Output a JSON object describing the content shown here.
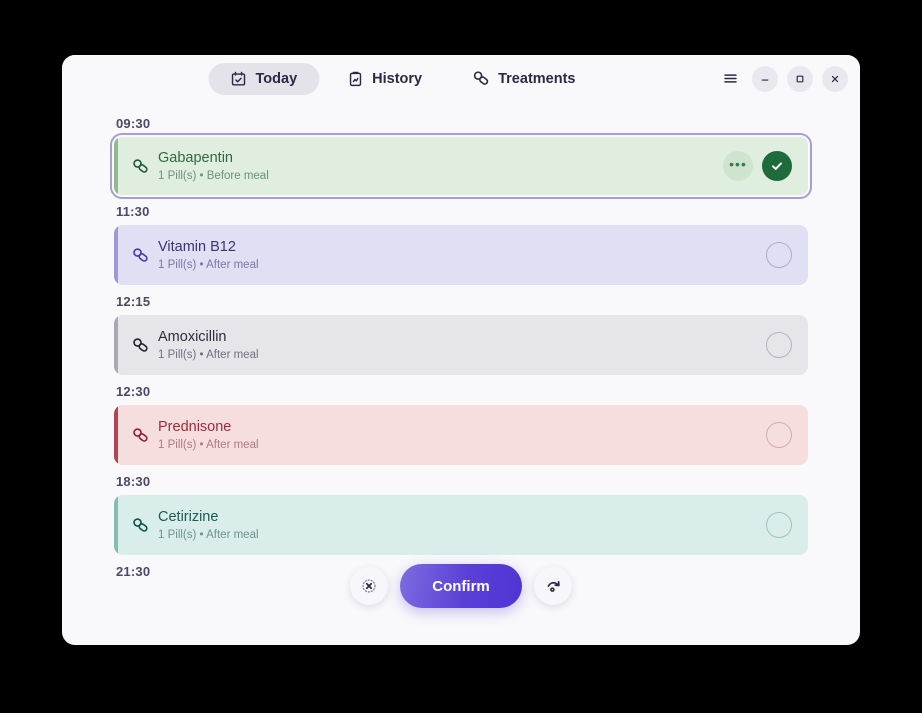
{
  "window": {
    "tabs": [
      {
        "label": "Today",
        "icon": "calendar-check-icon",
        "active": true
      },
      {
        "label": "History",
        "icon": "clipboard-history-icon",
        "active": false
      },
      {
        "label": "Treatments",
        "icon": "pill-icon",
        "active": false
      }
    ],
    "controls": [
      {
        "name": "menu-button",
        "icon": "hamburger-icon",
        "glyph": "☰"
      },
      {
        "name": "minimize-button",
        "icon": "minimize-icon",
        "glyph": "–"
      },
      {
        "name": "maximize-button",
        "icon": "maximize-icon",
        "glyph": "□"
      },
      {
        "name": "close-button",
        "icon": "close-icon",
        "glyph": "×"
      }
    ]
  },
  "schedule": [
    {
      "time": "09:30",
      "name": "Gabapentin",
      "detail": "1 Pill(s)  •  Before meal",
      "state": "taken",
      "focused": true,
      "colors": {
        "bg": "#dfeedf",
        "accent": "#8fba8f",
        "name": "#2f6b3f",
        "sub": "#6b9478",
        "icon": "#1f5c34",
        "more_bg": "#cfe4cf",
        "more_fg": "#3d7a4f",
        "check_bg": "#1f6b3c",
        "check_fg": "#ffffff"
      },
      "more_label": "•••",
      "has_more": true
    },
    {
      "time": "11:30",
      "name": "Vitamin B12",
      "detail": "1 Pill(s)  •  After meal",
      "state": "pending",
      "focused": false,
      "colors": {
        "bg": "#e0dff3",
        "accent": "#9f98d8",
        "name": "#3b3570",
        "sub": "#7d77a8",
        "icon": "#4a37a8",
        "radio": "#b0aad4"
      },
      "has_more": false
    },
    {
      "time": "12:15",
      "name": "Amoxicillin",
      "detail": "1 Pill(s)  •  After meal",
      "state": "pending",
      "focused": false,
      "colors": {
        "bg": "#e5e5ea",
        "accent": "#a9a9b6",
        "name": "#2f2f3d",
        "sub": "#72727f",
        "icon": "#23232e",
        "radio": "#b3b3bd"
      },
      "has_more": false
    },
    {
      "time": "12:30",
      "name": "Prednisone",
      "detail": "1 Pill(s)  •  After meal",
      "state": "pending",
      "focused": false,
      "colors": {
        "bg": "#f6dedf",
        "accent": "#b3434f",
        "name": "#9e2b3c",
        "sub": "#b07a80",
        "icon": "#8e1f33",
        "radio": "#d8a9ae"
      },
      "has_more": false
    },
    {
      "time": "18:30",
      "name": "Cetirizine",
      "detail": "1 Pill(s)  •  After meal",
      "state": "pending",
      "focused": false,
      "colors": {
        "bg": "#d9edea",
        "accent": "#84bcb6",
        "name": "#1d5b55",
        "sub": "#70938f",
        "icon": "#10504b",
        "radio": "#9dc4bf"
      },
      "has_more": false
    },
    {
      "time": "21:30",
      "name": "",
      "detail": "",
      "state": "cut-off",
      "focused": false,
      "colors": {},
      "has_more": false
    }
  ],
  "action_bar": {
    "skip_label": "skip",
    "skip_icon": "dotted-circle-x-icon",
    "confirm_label": "Confirm",
    "snooze_label": "snooze",
    "snooze_icon": "redo-arrow-icon"
  }
}
